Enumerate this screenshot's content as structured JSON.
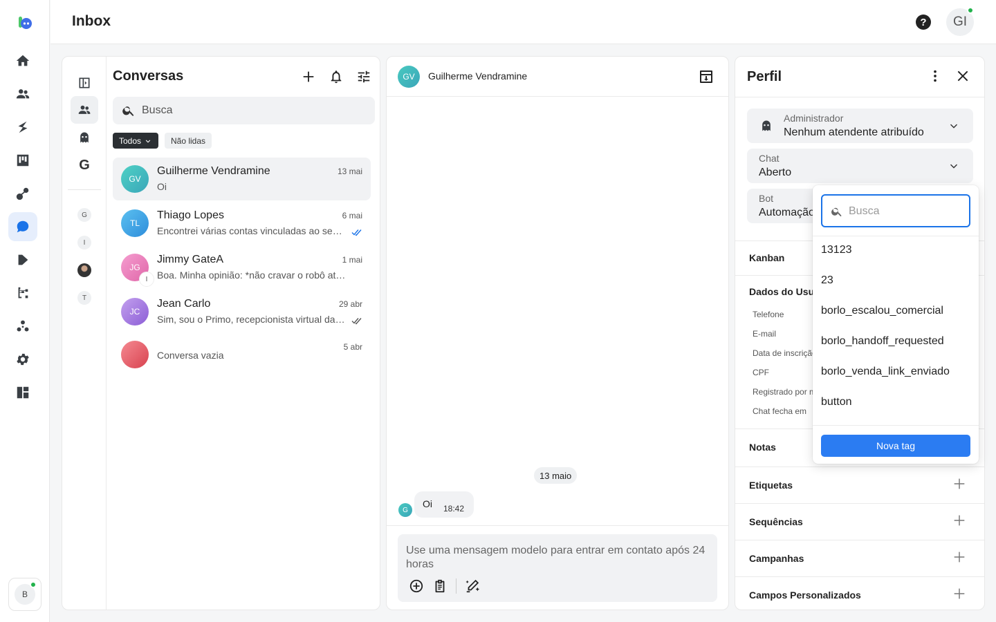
{
  "header": {
    "title": "Inbox",
    "help_glyph": "?",
    "user_initials": "GI"
  },
  "rail": {
    "items": [
      "home-icon",
      "contacts-icon",
      "flows-icon",
      "kanban-icon",
      "broadcast-icon",
      "inbox-icon",
      "play-icon",
      "automation-icon",
      "integrations-icon",
      "settings-icon",
      "dashboard-icon"
    ],
    "active": "inbox-icon",
    "bot_initial": "B"
  },
  "filters": {
    "gletter": "G",
    "mini": [
      "G",
      "I",
      "",
      "T"
    ]
  },
  "conversations": {
    "title": "Conversas",
    "search_placeholder": "Busca",
    "chip_all": "Todos",
    "chip_unread": "Não lidas",
    "items": [
      {
        "initials": "GV",
        "name": "Guilherme Vendramine",
        "date": "13 mai",
        "preview": "Oi",
        "gradient": [
          "#4fd1c5",
          "#3aa6b9"
        ],
        "check": "none",
        "badge": ""
      },
      {
        "initials": "TL",
        "name": "Thiago Lopes",
        "date": "6 mai",
        "preview": "Encontrei várias contas vinculadas ao seu e-mail",
        "gradient": [
          "#5bc0f0",
          "#2e8ddb"
        ],
        "check": "blue",
        "badge": ""
      },
      {
        "initials": "JG",
        "name": "Jimmy GateA",
        "date": "1 mai",
        "preview": "Boa. Minha opinião: *não cravar o robô atual como",
        "gradient": [
          "#f59ed0",
          "#e066a8"
        ],
        "check": "none",
        "badge": "I"
      },
      {
        "initials": "JC",
        "name": "Jean Carlo",
        "date": "29 abr",
        "preview": "Sim, sou o Primo, recepcionista virtual da empresa",
        "gradient": [
          "#c3a0ee",
          "#8c5ed6"
        ],
        "check": "gray",
        "badge": ""
      },
      {
        "initials": "",
        "name": "",
        "date": "5 abr",
        "preview": "Conversa vazia",
        "gradient": [
          "#f58a92",
          "#d8424f"
        ],
        "check": "none",
        "badge": ""
      }
    ]
  },
  "chat": {
    "contact_initials": "GV",
    "contact_name": "Guilherme Vendramine",
    "day_label": "13 maio",
    "message": {
      "sender_initial": "G",
      "text": "Oi",
      "time": "18:42"
    },
    "composer_placeholder": "Use uma mensagem modelo para entrar em contato após 24 horas"
  },
  "profile": {
    "title": "Perfil",
    "assignee": {
      "label": "Administrador",
      "value": "Nenhum atendente atribuído"
    },
    "chat_status": {
      "label": "Chat",
      "value": "Aberto"
    },
    "bot": {
      "label": "Bot",
      "value": "Automação"
    },
    "kanban_label": "Kanban",
    "user_data_label": "Dados do Usuário",
    "fields": [
      "Telefone",
      "E-mail",
      "Data de inscrição",
      "CPF",
      "Registrado por meio de",
      "Chat fecha em"
    ],
    "notes_label": "Notas",
    "sections": [
      "Etiquetas",
      "Sequências",
      "Campanhas",
      "Campos Personalizados"
    ]
  },
  "tag_dropdown": {
    "search_placeholder": "Busca",
    "options": [
      "13123",
      "23",
      "borlo_escalou_comercial",
      "borlo_handoff_requested",
      "borlo_venda_link_enviado",
      "button"
    ],
    "new_tag_label": "Nova tag"
  },
  "colors": {
    "accent": "#1a73e8",
    "button": "#2b7cf2",
    "online": "#22b24c",
    "check_blue": "#1a73e8"
  }
}
